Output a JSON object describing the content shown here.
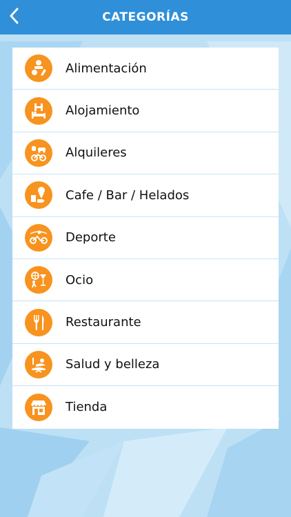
{
  "header": {
    "title": "CATEGORÍAS",
    "back_icon": "chevron-left-icon",
    "background": "#2f8fd8"
  },
  "accent_color": "#f7931e",
  "categories": [
    {
      "label": "Alimentación",
      "icon": "food-icon"
    },
    {
      "label": "Alojamiento",
      "icon": "hotel-icon"
    },
    {
      "label": "Alquileres",
      "icon": "rental-icon"
    },
    {
      "label": "Cafe / Bar / Helados",
      "icon": "cafe-icon"
    },
    {
      "label": "Deporte",
      "icon": "sport-icon"
    },
    {
      "label": "Ocio",
      "icon": "leisure-icon"
    },
    {
      "label": "Restaurante",
      "icon": "restaurant-icon"
    },
    {
      "label": "Salud y belleza",
      "icon": "spa-icon"
    },
    {
      "label": "Tienda",
      "icon": "shop-icon"
    }
  ]
}
